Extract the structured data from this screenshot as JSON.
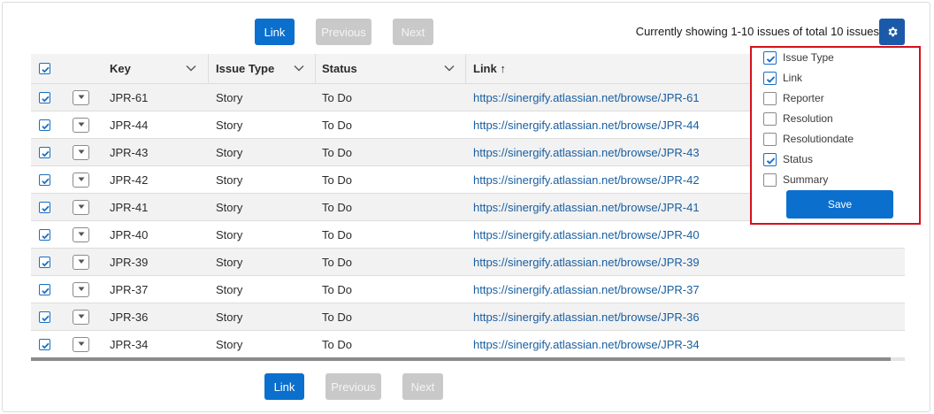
{
  "pagination_top": {
    "link_label": "Link",
    "previous_label": "Previous",
    "next_label": "Next"
  },
  "pagination_bottom": {
    "link_label": "Link",
    "previous_label": "Previous",
    "next_label": "Next"
  },
  "status_text": "Currently showing 1-10 issues of total 10 issues",
  "settings_icon": "gear-icon",
  "table": {
    "columns": [
      "Key",
      "Issue Type",
      "Status",
      "Link ↑"
    ],
    "header_checkbox_checked": true,
    "rows": [
      {
        "key": "JPR-61",
        "type": "Story",
        "status": "To Do",
        "link": "https://sinergify.atlassian.net/browse/JPR-61",
        "checked": true
      },
      {
        "key": "JPR-44",
        "type": "Story",
        "status": "To Do",
        "link": "https://sinergify.atlassian.net/browse/JPR-44",
        "checked": true
      },
      {
        "key": "JPR-43",
        "type": "Story",
        "status": "To Do",
        "link": "https://sinergify.atlassian.net/browse/JPR-43",
        "checked": true
      },
      {
        "key": "JPR-42",
        "type": "Story",
        "status": "To Do",
        "link": "https://sinergify.atlassian.net/browse/JPR-42",
        "checked": true
      },
      {
        "key": "JPR-41",
        "type": "Story",
        "status": "To Do",
        "link": "https://sinergify.atlassian.net/browse/JPR-41",
        "checked": true
      },
      {
        "key": "JPR-40",
        "type": "Story",
        "status": "To Do",
        "link": "https://sinergify.atlassian.net/browse/JPR-40",
        "checked": true
      },
      {
        "key": "JPR-39",
        "type": "Story",
        "status": "To Do",
        "link": "https://sinergify.atlassian.net/browse/JPR-39",
        "checked": true
      },
      {
        "key": "JPR-37",
        "type": "Story",
        "status": "To Do",
        "link": "https://sinergify.atlassian.net/browse/JPR-37",
        "checked": true
      },
      {
        "key": "JPR-36",
        "type": "Story",
        "status": "To Do",
        "link": "https://sinergify.atlassian.net/browse/JPR-36",
        "checked": true
      },
      {
        "key": "JPR-34",
        "type": "Story",
        "status": "To Do",
        "link": "https://sinergify.atlassian.net/browse/JPR-34",
        "checked": true
      }
    ]
  },
  "column_picker": {
    "options": [
      {
        "label": "Issue Type",
        "checked": true
      },
      {
        "label": "Link",
        "checked": true
      },
      {
        "label": "Reporter",
        "checked": false
      },
      {
        "label": "Resolution",
        "checked": false
      },
      {
        "label": "Resolutiondate",
        "checked": false
      },
      {
        "label": "Status",
        "checked": true
      },
      {
        "label": "Summary",
        "checked": false
      }
    ],
    "save_label": "Save"
  },
  "colors": {
    "primary": "#0b6fce",
    "disabled": "#c9c9c9",
    "settings": "#1b5aa8",
    "highlight_border": "#d6101c",
    "link": "#1a5fa0"
  }
}
